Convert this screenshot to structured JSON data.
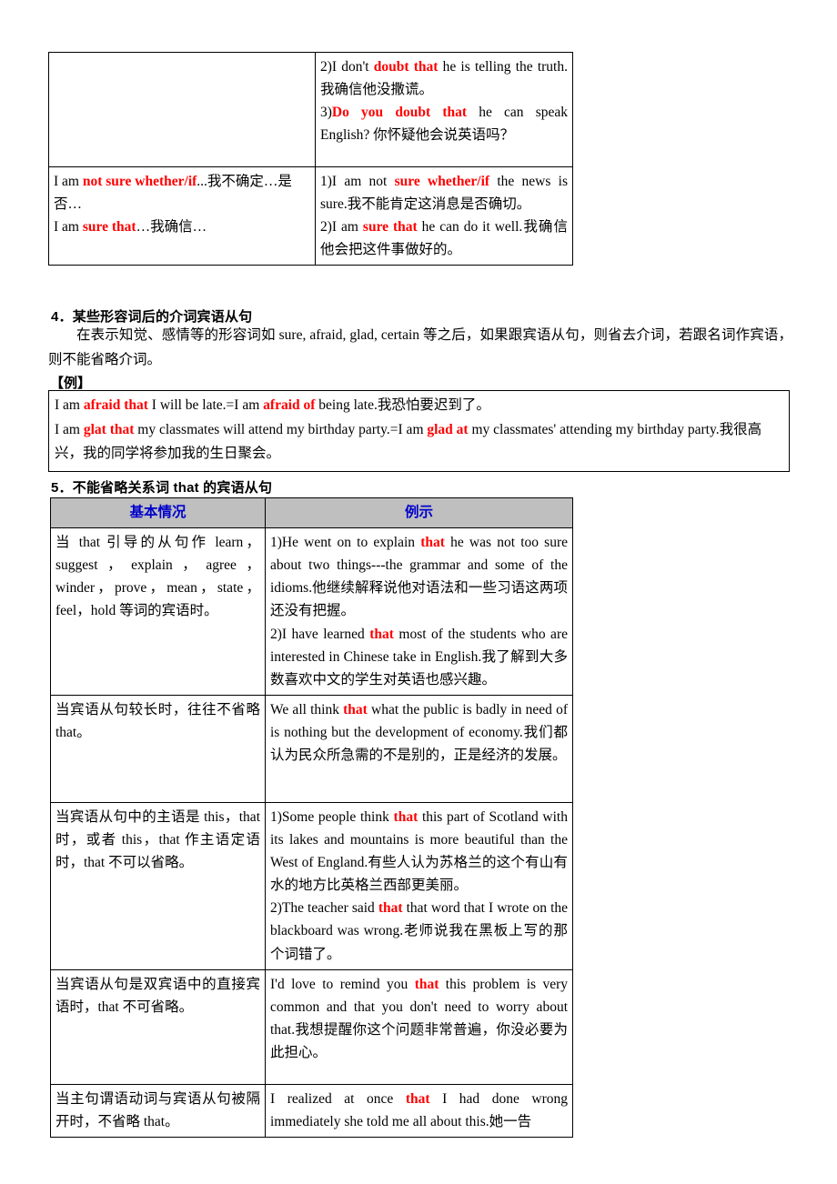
{
  "colors": {
    "emphasis_red": "#ff0000",
    "header_blue": "#0000cc",
    "header_gray_bg": "#bfbfbf",
    "rule_black": "#000000"
  },
  "top_table": {
    "rows": [
      {
        "left": "",
        "right_lines": [
          "2)I don't doubt that he is telling the truth. 我确信他没撒谎。",
          "3)Do you doubt that he can speak English? 你怀疑他会说英语吗？"
        ]
      },
      {
        "left_lines": [
          "I am not sure whether/if...我不确定…是否…",
          "I am sure that…我确信…"
        ],
        "right_lines": [
          "1)I am not sure whether/if the news is sure.我不能肯定这消息是否确切。",
          "2)I am sure that he can do it well.我确信他会把这件事做好的。"
        ]
      }
    ],
    "row1": {
      "line_a_pre": "2)I don't ",
      "line_a_em": "doubt that",
      "line_a_post": " he is telling the truth. 我确信他没撒谎。",
      "line_b_pre": "3)",
      "line_b_em": "Do you doubt that",
      "line_b_post": " he can speak English? 你怀疑他会说英语吗？"
    },
    "row2": {
      "left_a_pre": "I am ",
      "left_a_em": "not sure whether/if",
      "left_a_post": "...我不确定…是否…",
      "left_b_pre": "I am ",
      "left_b_em": "sure that",
      "left_b_post": "…我确信…",
      "right_a_pre": "1)I am not ",
      "right_a_em": "sure whether/if",
      "right_a_post": " the news is sure.我不能肯定这消息是否确切。",
      "right_b_pre": "2)I am ",
      "right_b_em": "sure that",
      "right_b_post": " he can do it well.我确信他会把这件事做好的。"
    }
  },
  "section4": {
    "heading": "4．某些形容词后的介词宾语从句",
    "body_p1": "在表示知觉、感情等的形容词如 sure, afraid, glad, certain 等之后，如果跟宾语从句，则省去介词，若跟名词作宾语，则不能省略介词。",
    "example_label": "【例】",
    "example": {
      "line1_pre": "I am ",
      "line1_em1": "afraid that",
      "line1_mid": " I will be late.=I am ",
      "line1_em2": "afraid of",
      "line1_post": " being late.我恐怕要迟到了。",
      "line2_pre": "I am ",
      "line2_em1": "glat that",
      "line2_mid": " my classmates will attend my birthday party.=I am ",
      "line2_em2": "glad at",
      "line2_post": " my classmates' attending my birthday party.我很高兴，我的同学将参加我的生日聚会。"
    }
  },
  "section5": {
    "heading": "5．不能省略关系词 that 的宾语从句",
    "table": {
      "headers": [
        "基本情况",
        "例示"
      ],
      "rows": [
        {
          "condition": "当 that 引导的从句作 learn，suggest，explain，agree，winder，prove，mean，state，feel，hold 等词的宾语时。",
          "example_1_pre": "1)He went on to explain ",
          "example_1_em": "that",
          "example_1_post": " he was not too sure about two things---the grammar and some of the idioms.他继续解释说他对语法和一些习语这两项还没有把握。",
          "example_2_pre": "2)I have learned ",
          "example_2_em": "that",
          "example_2_post": " most of the students who are interested in Chinese take in English.我了解到大多数喜欢中文的学生对英语也感兴趣。"
        },
        {
          "condition": "当宾语从句较长时，往往不省略 that。",
          "example_1_pre": "We all think ",
          "example_1_em": "that",
          "example_1_post": " what the public is badly in need of is nothing but the development of economy.我们都认为民众所急需的不是别的，正是经济的发展。"
        },
        {
          "condition": "当宾语从句中的主语是 this，that 时，或者 this，that 作主语定语时，that 不可以省略。",
          "example_1_pre": "1)Some people think ",
          "example_1_em": "that",
          "example_1_post": " this part of Scotland with its lakes and mountains is more beautiful than the West of England.有些人认为苏格兰的这个有山有水的地方比英格兰西部更美丽。",
          "example_2_pre": "2)The teacher said ",
          "example_2_em": "that",
          "example_2_post": " that word that I wrote on the blackboard was wrong.老师说我在黑板上写的那个词错了。"
        },
        {
          "condition": "当宾语从句是双宾语中的直接宾语时，that 不可省略。",
          "example_1_pre": "I'd love to remind you ",
          "example_1_em": "that",
          "example_1_post": " this problem is very common and that you don't need to worry about that.我想提醒你这个问题非常普遍，你没必要为此担心。"
        },
        {
          "condition": "当主句谓语动词与宾语从句被隔开时，不省略 that。",
          "example_1_pre": "I realized at once ",
          "example_1_em": "that",
          "example_1_post": " I had done wrong immediately she told me all about this.她一告"
        }
      ]
    }
  }
}
